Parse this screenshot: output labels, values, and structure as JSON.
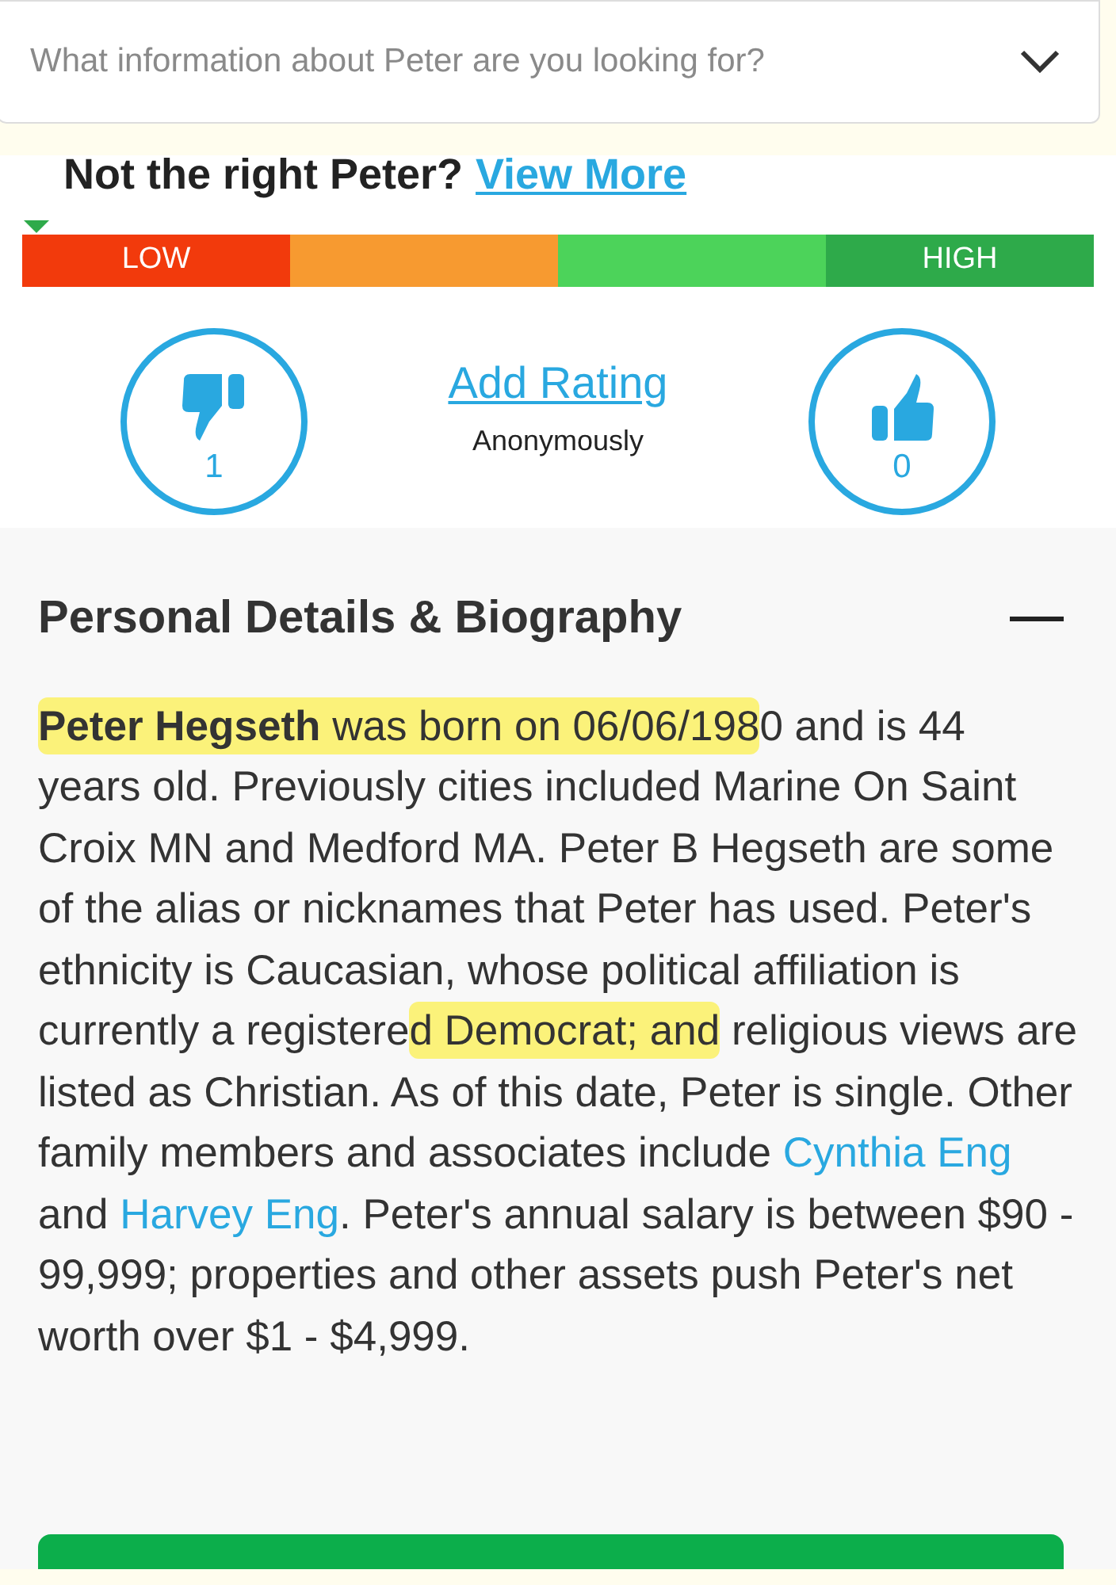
{
  "search_select": {
    "placeholder": "What information about Peter are you looking for?"
  },
  "not_right": {
    "text": "Not the right Peter?",
    "link": "View More"
  },
  "meter": {
    "segments": [
      {
        "label": "LOW",
        "color": "#f23a0c"
      },
      {
        "color": "#f79a30"
      },
      {
        "color": "#4cd35a"
      },
      {
        "label": "HIGH",
        "color": "#2eaa4a"
      }
    ]
  },
  "rating": {
    "dislikes": "1",
    "link": "Add Rating",
    "note": "Anonymously",
    "likes": "0"
  },
  "section": {
    "title": "Personal Details & Biography",
    "expanded": true,
    "bio": [
      {
        "kind": "text",
        "highlighted": true,
        "text": "**Peter Hegseth** was born on 06/06/198"
      },
      {
        "kind": "text",
        "highlighted": false,
        "text": "0 and is 44 years old. Previously cities included Marine On Saint Croix MN and Medford MA. Peter B Hegseth are some of the alias or nicknames that Peter has used. Peter's ethnicity is Caucasian, whose political affiliation is currently a registere"
      },
      {
        "kind": "text",
        "highlighted": true,
        "text": "d Democrat; and"
      },
      {
        "kind": "text",
        "highlighted": false,
        "text": " religious views are listed as Christian. As of this date, Peter is single. Other family members and associates include "
      },
      {
        "kind": "link",
        "text": "Cynthia Eng"
      },
      {
        "kind": "text",
        "highlighted": false,
        "text": " and "
      },
      {
        "kind": "link",
        "text": "Harvey Eng"
      },
      {
        "kind": "text",
        "highlighted": false,
        "text": ". Peter's annual salary is between $90 - 99,999; properties and other assets push Peter's net worth over $1 - $4,999."
      }
    ]
  }
}
